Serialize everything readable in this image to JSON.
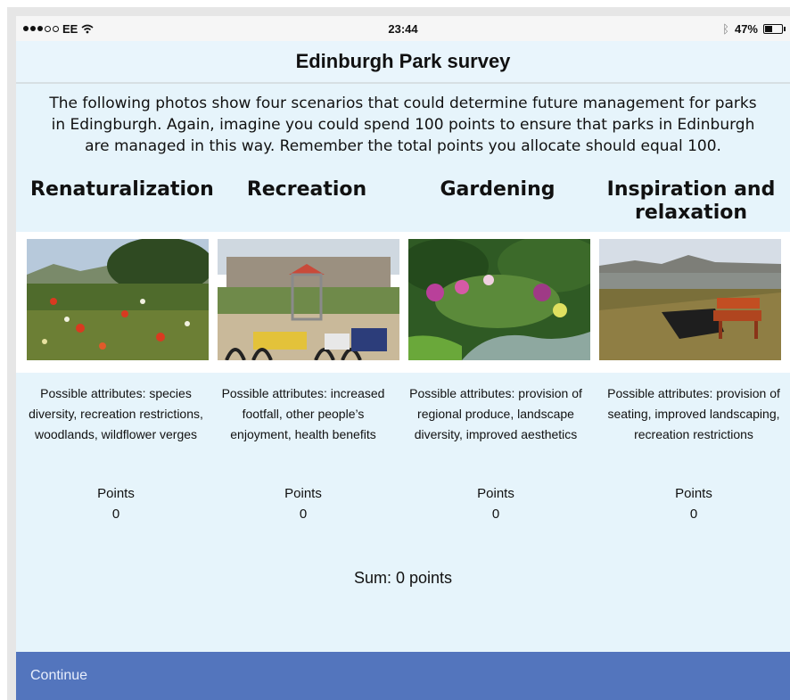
{
  "status_bar": {
    "carrier": "EE",
    "time": "23:44",
    "battery": "47%",
    "battery_level": 0.47
  },
  "header": {
    "title": "Edinburgh Park survey"
  },
  "intro": "The following photos show four scenarios that could determine future management for parks in Edingburgh. Again, imagine you could spend 100 points to ensure that parks in Edinburgh are managed in this way. Remember the total points you allocate should equal 100.",
  "columns": [
    {
      "title": "Renaturalization",
      "image": "wildflower-meadow-photo",
      "attributes": "Possible attributes: species diversity, recreation restrictions, woodlands, wildflower verges",
      "points_label": "Points",
      "points": "0"
    },
    {
      "title": "Recreation",
      "image": "playground-photo",
      "attributes": "Possible attributes: increased footfall, other people’s enjoyment, health benefits",
      "points_label": "Points",
      "points": "0"
    },
    {
      "title": "Gardening",
      "image": "garden-flowerbed-photo",
      "attributes": "Possible attributes: provision of regional produce, landscape diversity, improved aesthetics",
      "points_label": "Points",
      "points": "0"
    },
    {
      "title": "Inspiration and relaxation",
      "image": "park-bench-view-photo",
      "attributes": "Possible attributes: provision of seating, improved landscaping, recreation restrictions",
      "points_label": "Points",
      "points": "0"
    }
  ],
  "sum_label": "Sum: 0 points",
  "continue_label": "Continue",
  "colors": {
    "page_bg": "#e6f4fb",
    "nav_bg": "#e9f5fc",
    "continue_bg": "#5375bd",
    "continue_text": "#e8eefc"
  }
}
